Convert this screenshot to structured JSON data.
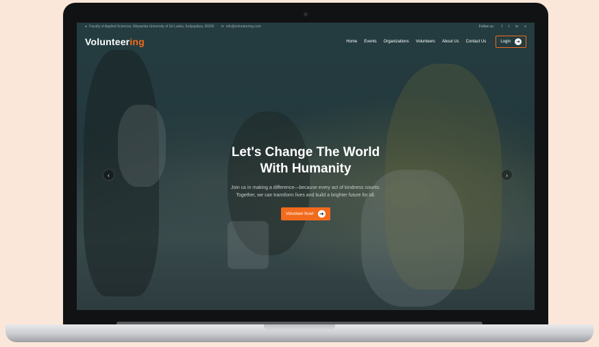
{
  "topbar": {
    "address": "Faculty of Applied Sciences, Wayamba University of Sri Lanka, Kuliyapitiya, 60200",
    "email": "info@volunteering.com",
    "follow_label": "Follow us :",
    "social": [
      "f",
      "t",
      "in",
      "o"
    ]
  },
  "nav": {
    "logo_main": "Volunteer",
    "logo_accent": "ing",
    "links": [
      "Home",
      "Events",
      "Organizations",
      "Volunteers",
      "About Us",
      "Contact Us"
    ],
    "login_label": "Login"
  },
  "hero": {
    "title_line1": "Let's Change The World",
    "title_line2": "With Humanity",
    "subtitle_line1": "Join us in making a difference—because every act of kindness counts.",
    "subtitle_line2": "Together, we can transform lives and build a brighter future for all.",
    "cta_label": "Volunteer Now!"
  },
  "colors": {
    "accent": "#f26b1d",
    "background": "#fbe7da"
  }
}
